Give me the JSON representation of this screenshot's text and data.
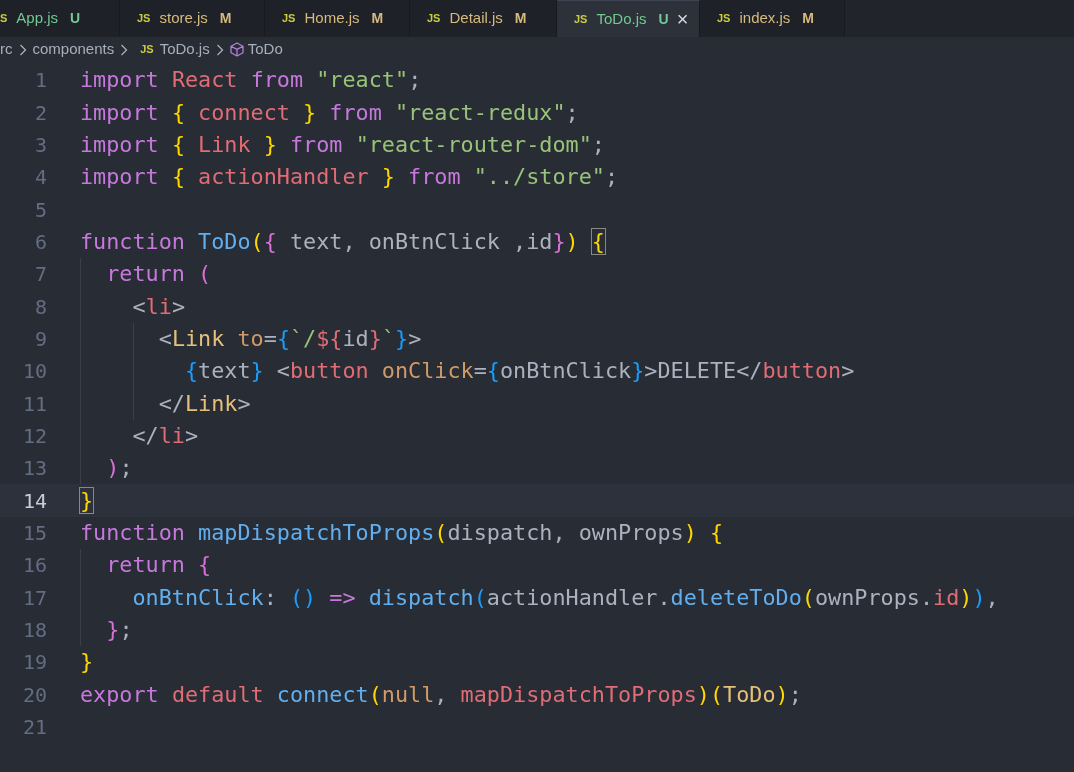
{
  "tabs": [
    {
      "icon": "S",
      "label": "App.js",
      "status": "U",
      "color": "#73c991",
      "selected": false
    },
    {
      "icon": "JS",
      "label": "store.js",
      "status": "M",
      "color": "#d7ba7d",
      "selected": false
    },
    {
      "icon": "JS",
      "label": "Home.js",
      "status": "M",
      "color": "#d7ba7d",
      "selected": false
    },
    {
      "icon": "JS",
      "label": "Detail.js",
      "status": "M",
      "color": "#d7ba7d",
      "selected": false
    },
    {
      "icon": "JS",
      "label": "ToDo.js",
      "status": "U",
      "color": "#73c991",
      "selected": true,
      "close": "×"
    },
    {
      "icon": "JS",
      "label": "index.js",
      "status": "M",
      "color": "#d7ba7d",
      "selected": false
    }
  ],
  "breadcrumb": [
    {
      "kind": "folder",
      "label": "rc"
    },
    {
      "kind": "folder",
      "label": "components"
    },
    {
      "kind": "file",
      "icon": "JS",
      "label": "ToDo.js"
    },
    {
      "kind": "symbol",
      "label": "ToDo"
    }
  ],
  "editor": {
    "lines": [
      {
        "number": "1",
        "current": false,
        "tokens": [
          {
            "text": "import ",
            "kind": "kw"
          },
          {
            "text": "React ",
            "kind": "var"
          },
          {
            "text": "from ",
            "kind": "kw"
          },
          {
            "text": "\"react\"",
            "kind": "str"
          },
          {
            "text": ";",
            "kind": "plain"
          }
        ]
      },
      {
        "number": "2",
        "current": false,
        "tokens": [
          {
            "text": "import ",
            "kind": "kw"
          },
          {
            "text": "{",
            "kind": "b1"
          },
          {
            "text": " connect ",
            "kind": "var"
          },
          {
            "text": "}",
            "kind": "b1"
          },
          {
            "text": " from ",
            "kind": "kw"
          },
          {
            "text": "\"react-redux\"",
            "kind": "str"
          },
          {
            "text": ";",
            "kind": "plain"
          }
        ]
      },
      {
        "number": "3",
        "current": false,
        "tokens": [
          {
            "text": "import ",
            "kind": "kw"
          },
          {
            "text": "{",
            "kind": "b1"
          },
          {
            "text": " Link ",
            "kind": "var"
          },
          {
            "text": "}",
            "kind": "b1"
          },
          {
            "text": " from ",
            "kind": "kw"
          },
          {
            "text": "\"react-router-dom\"",
            "kind": "str"
          },
          {
            "text": ";",
            "kind": "plain"
          }
        ]
      },
      {
        "number": "4",
        "current": false,
        "tokens": [
          {
            "text": "import ",
            "kind": "kw"
          },
          {
            "text": "{",
            "kind": "b1"
          },
          {
            "text": " actionHandler ",
            "kind": "var"
          },
          {
            "text": "}",
            "kind": "b1"
          },
          {
            "text": " from ",
            "kind": "kw"
          },
          {
            "text": "\"../store\"",
            "kind": "str"
          },
          {
            "text": ";",
            "kind": "plain"
          }
        ]
      },
      {
        "number": "5",
        "current": false
      },
      {
        "number": "6",
        "current": false,
        "tokens": [
          {
            "text": "function ",
            "kind": "kw"
          },
          {
            "text": "ToDo",
            "kind": "fn"
          },
          {
            "text": "(",
            "kind": "b1"
          },
          {
            "text": "{",
            "kind": "b2"
          },
          {
            "text": " text, onBtnClick ,id",
            "kind": "plain"
          },
          {
            "text": "}",
            "kind": "b2"
          },
          {
            "text": ") ",
            "kind": "b1"
          },
          {
            "text": "{",
            "kind": "b1",
            "match": true
          }
        ]
      },
      {
        "number": "7",
        "current": false,
        "tokens": [
          {
            "text": "  return ",
            "kind": "kw"
          },
          {
            "text": "(",
            "kind": "b2"
          }
        ]
      },
      {
        "number": "8",
        "current": false,
        "tokens": [
          {
            "text": "    <",
            "kind": "plain"
          },
          {
            "text": "li",
            "kind": "tag"
          },
          {
            "text": ">",
            "kind": "plain"
          }
        ]
      },
      {
        "number": "9",
        "current": false,
        "tokens": [
          {
            "text": "      <",
            "kind": "plain"
          },
          {
            "text": "Link",
            "kind": "comp"
          },
          {
            "text": " to",
            "kind": "attr"
          },
          {
            "text": "=",
            "kind": "plain"
          },
          {
            "text": "{",
            "kind": "b3"
          },
          {
            "text": "`/",
            "kind": "str"
          },
          {
            "text": "${",
            "kind": "var"
          },
          {
            "text": "id",
            "kind": "plain"
          },
          {
            "text": "}",
            "kind": "var"
          },
          {
            "text": "`",
            "kind": "str"
          },
          {
            "text": "}",
            "kind": "b3"
          },
          {
            "text": ">",
            "kind": "plain"
          }
        ]
      },
      {
        "number": "10",
        "current": false,
        "tokens": [
          {
            "text": "        {",
            "kind": "b3"
          },
          {
            "text": "text",
            "kind": "plain"
          },
          {
            "text": "}",
            "kind": "b3"
          },
          {
            "text": " <",
            "kind": "plain"
          },
          {
            "text": "button",
            "kind": "tag"
          },
          {
            "text": " onClick",
            "kind": "attr"
          },
          {
            "text": "=",
            "kind": "plain"
          },
          {
            "text": "{",
            "kind": "b3"
          },
          {
            "text": "onBtnClick",
            "kind": "plain"
          },
          {
            "text": "}",
            "kind": "b3"
          },
          {
            "text": ">DELETE</",
            "kind": "plain"
          },
          {
            "text": "button",
            "kind": "tag"
          },
          {
            "text": ">",
            "kind": "plain"
          }
        ]
      },
      {
        "number": "11",
        "current": false,
        "tokens": [
          {
            "text": "      </",
            "kind": "plain"
          },
          {
            "text": "Link",
            "kind": "comp"
          },
          {
            "text": ">",
            "kind": "plain"
          }
        ]
      },
      {
        "number": "12",
        "current": false,
        "tokens": [
          {
            "text": "    </",
            "kind": "plain"
          },
          {
            "text": "li",
            "kind": "tag"
          },
          {
            "text": ">",
            "kind": "plain"
          }
        ]
      },
      {
        "number": "13",
        "current": false,
        "tokens": [
          {
            "text": "  )",
            "kind": "b2"
          },
          {
            "text": ";",
            "kind": "plain"
          }
        ]
      },
      {
        "number": "14",
        "current": true,
        "tokens": [
          {
            "text": "}",
            "kind": "b1",
            "match": true
          }
        ]
      },
      {
        "number": "15",
        "current": false,
        "tokens": [
          {
            "text": "function ",
            "kind": "kw"
          },
          {
            "text": "mapDispatchToProps",
            "kind": "fn"
          },
          {
            "text": "(",
            "kind": "b1"
          },
          {
            "text": "dispatch, ownProps",
            "kind": "plain"
          },
          {
            "text": ") {",
            "kind": "b1"
          }
        ]
      },
      {
        "number": "16",
        "current": false,
        "tokens": [
          {
            "text": "  return ",
            "kind": "kw"
          },
          {
            "text": "{",
            "kind": "b2"
          }
        ]
      },
      {
        "number": "17",
        "current": false,
        "tokens": [
          {
            "text": "    onBtnClick",
            "kind": "fn"
          },
          {
            "text": ": ",
            "kind": "plain"
          },
          {
            "text": "()",
            "kind": "b3"
          },
          {
            "text": " => ",
            "kind": "kw"
          },
          {
            "text": "dispatch",
            "kind": "fn"
          },
          {
            "text": "(",
            "kind": "b3"
          },
          {
            "text": "actionHandler.",
            "kind": "plain"
          },
          {
            "text": "deleteToDo",
            "kind": "fn"
          },
          {
            "text": "(",
            "kind": "b1"
          },
          {
            "text": "ownProps.",
            "kind": "plain"
          },
          {
            "text": "id",
            "kind": "var"
          },
          {
            "text": ")",
            "kind": "b1"
          },
          {
            "text": ")",
            "kind": "b3"
          },
          {
            "text": ",",
            "kind": "plain"
          }
        ]
      },
      {
        "number": "18",
        "current": false,
        "tokens": [
          {
            "text": "  }",
            "kind": "b2"
          },
          {
            "text": ";",
            "kind": "plain"
          }
        ]
      },
      {
        "number": "19",
        "current": false,
        "tokens": [
          {
            "text": "}",
            "kind": "b1"
          }
        ]
      },
      {
        "number": "20",
        "current": false,
        "tokens": [
          {
            "text": "export ",
            "kind": "kw"
          },
          {
            "text": "default ",
            "kind": "var"
          },
          {
            "text": "connect",
            "kind": "fn"
          },
          {
            "text": "(",
            "kind": "b1"
          },
          {
            "text": "null",
            "kind": "attr"
          },
          {
            "text": ", ",
            "kind": "plain"
          },
          {
            "text": "mapDispatchToProps",
            "kind": "var"
          },
          {
            "text": ")",
            "kind": "b1"
          },
          {
            "text": "(",
            "kind": "b1"
          },
          {
            "text": "ToDo",
            "kind": "comp"
          },
          {
            "text": ")",
            "kind": "b1"
          },
          {
            "text": ";",
            "kind": "plain"
          }
        ]
      },
      {
        "number": "21",
        "current": false
      }
    ]
  }
}
